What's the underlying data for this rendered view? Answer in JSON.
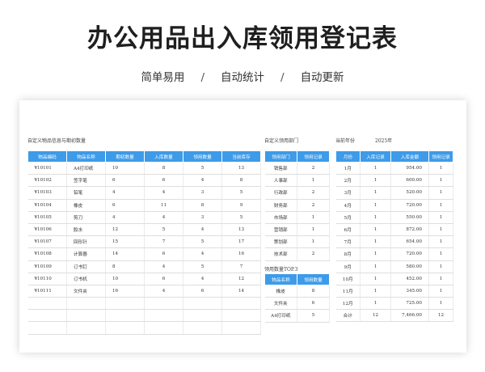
{
  "title": "办公用品出入库领用登记表",
  "subtitle": {
    "items": [
      "简单易用",
      "自动统计",
      "自动更新"
    ],
    "separator": "/"
  },
  "labels": {
    "items_info": "自定义物品信息与期初数量",
    "departments": "自定义领用部门",
    "year_label": "当前年份",
    "year_value": "2025年",
    "top3": "领用数量TOP.3"
  },
  "items_table": {
    "headers": [
      "物品编码",
      "物品名称",
      "期初数量",
      "入库数量",
      "领用数量",
      "当前库存"
    ],
    "rows": [
      [
        "¥10101",
        "A4打印纸",
        "10",
        "8",
        "5",
        "13"
      ],
      [
        "¥10102",
        "签字笔",
        "6",
        "6",
        "4",
        "8"
      ],
      [
        "¥10103",
        "铅笔",
        "4",
        "4",
        "3",
        "5"
      ],
      [
        "¥10104",
        "橡皮",
        "6",
        "11",
        "8",
        "9"
      ],
      [
        "¥10105",
        "剪刀",
        "4",
        "4",
        "3",
        "5"
      ],
      [
        "¥10106",
        "胶水",
        "12",
        "5",
        "4",
        "13"
      ],
      [
        "¥10107",
        "回形针",
        "15",
        "7",
        "5",
        "17"
      ],
      [
        "¥10108",
        "计算器",
        "14",
        "6",
        "4",
        "16"
      ],
      [
        "¥10109",
        "订书钉",
        "8",
        "4",
        "5",
        "7"
      ],
      [
        "¥10110",
        "订书机",
        "10",
        "6",
        "4",
        "12"
      ],
      [
        "¥10111",
        "文件夹",
        "16",
        "4",
        "6",
        "14"
      ]
    ]
  },
  "dept_table": {
    "headers": [
      "领用部门",
      "领用记录"
    ],
    "rows": [
      [
        "销售部",
        "2"
      ],
      [
        "人事部",
        "1"
      ],
      [
        "行政部",
        "2"
      ],
      [
        "财务部",
        "2"
      ],
      [
        "市场部",
        "1"
      ],
      [
        "营销部",
        "1"
      ],
      [
        "策划部",
        "1"
      ],
      [
        "技术部",
        "2"
      ]
    ]
  },
  "top_table": {
    "headers": [
      "物品名称",
      "领用数量"
    ],
    "rows": [
      [
        "橡皮",
        "8"
      ],
      [
        "文件夹",
        "6"
      ],
      [
        "A4打印纸",
        "5"
      ]
    ]
  },
  "month_table": {
    "headers": [
      "月份",
      "入库记录",
      "入库金额",
      "领用记录"
    ],
    "rows": [
      [
        "1月",
        "1",
        "954.00",
        "1"
      ],
      [
        "2月",
        "1",
        "600.00",
        "1"
      ],
      [
        "3月",
        "1",
        "520.00",
        "1"
      ],
      [
        "4月",
        "1",
        "720.00",
        "1"
      ],
      [
        "5月",
        "1",
        "550.00",
        "1"
      ],
      [
        "6月",
        "1",
        "872.00",
        "1"
      ],
      [
        "7月",
        "1",
        "654.00",
        "1"
      ],
      [
        "8月",
        "1",
        "720.00",
        "1"
      ],
      [
        "9月",
        "1",
        "580.00",
        "1"
      ],
      [
        "10月",
        "1",
        "452.00",
        "1"
      ],
      [
        "11月",
        "1",
        "345.00",
        "1"
      ],
      [
        "12月",
        "1",
        "725.00",
        "1"
      ]
    ],
    "total": [
      "合计",
      "12",
      "7,466.00",
      "12"
    ]
  }
}
